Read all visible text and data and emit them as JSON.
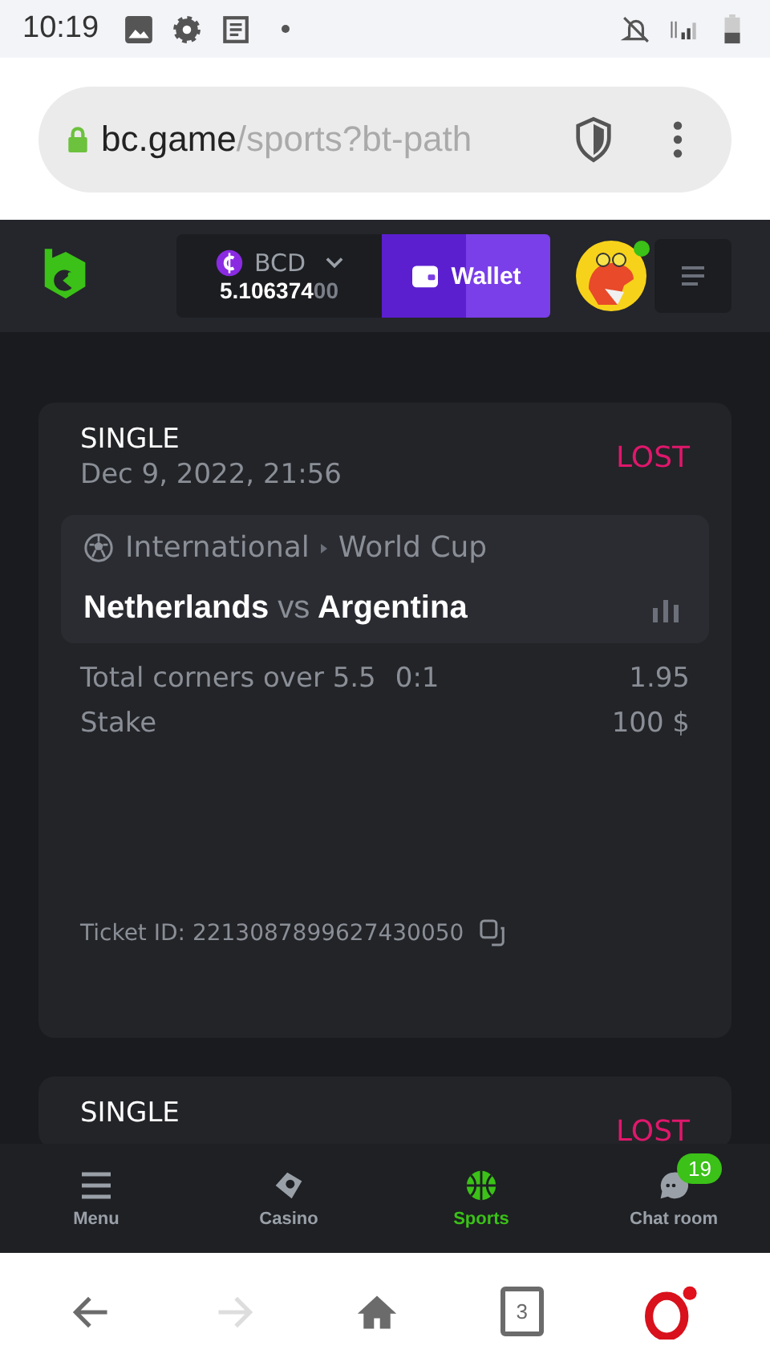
{
  "status_bar": {
    "time": "10:19"
  },
  "browser": {
    "url_host": "bc.game",
    "url_path": "/sports?bt-path"
  },
  "header": {
    "currency": "BCD",
    "balance_main": "5.106374",
    "balance_trailing": "00",
    "wallet_label": "Wallet",
    "online": true
  },
  "bets": [
    {
      "type": "SINGLE",
      "date": "Dec 9, 2022, 21:56",
      "result": "LOST",
      "league_region": "International",
      "league_name": "World Cup",
      "home": "Netherlands",
      "vs": "vs",
      "away": "Argentina",
      "market": "Total corners over 5.5",
      "score": "0:1",
      "odds": "1.95",
      "stake_label": "Stake",
      "stake": "100 $",
      "ticket": "Ticket ID: 2213087899627430050"
    },
    {
      "type": "SINGLE",
      "result": "LOST"
    }
  ],
  "bottom_nav": [
    {
      "kind": "menu",
      "label": "Menu",
      "selected": false
    },
    {
      "kind": "casino",
      "label": "Casino",
      "selected": false
    },
    {
      "kind": "sports",
      "label": "Sports",
      "selected": true
    },
    {
      "kind": "chat",
      "label": "Chat room",
      "selected": false,
      "badge": "19"
    }
  ],
  "browser_nav": {
    "back_disabled": false,
    "forward_disabled": true,
    "tab_count": "3"
  }
}
